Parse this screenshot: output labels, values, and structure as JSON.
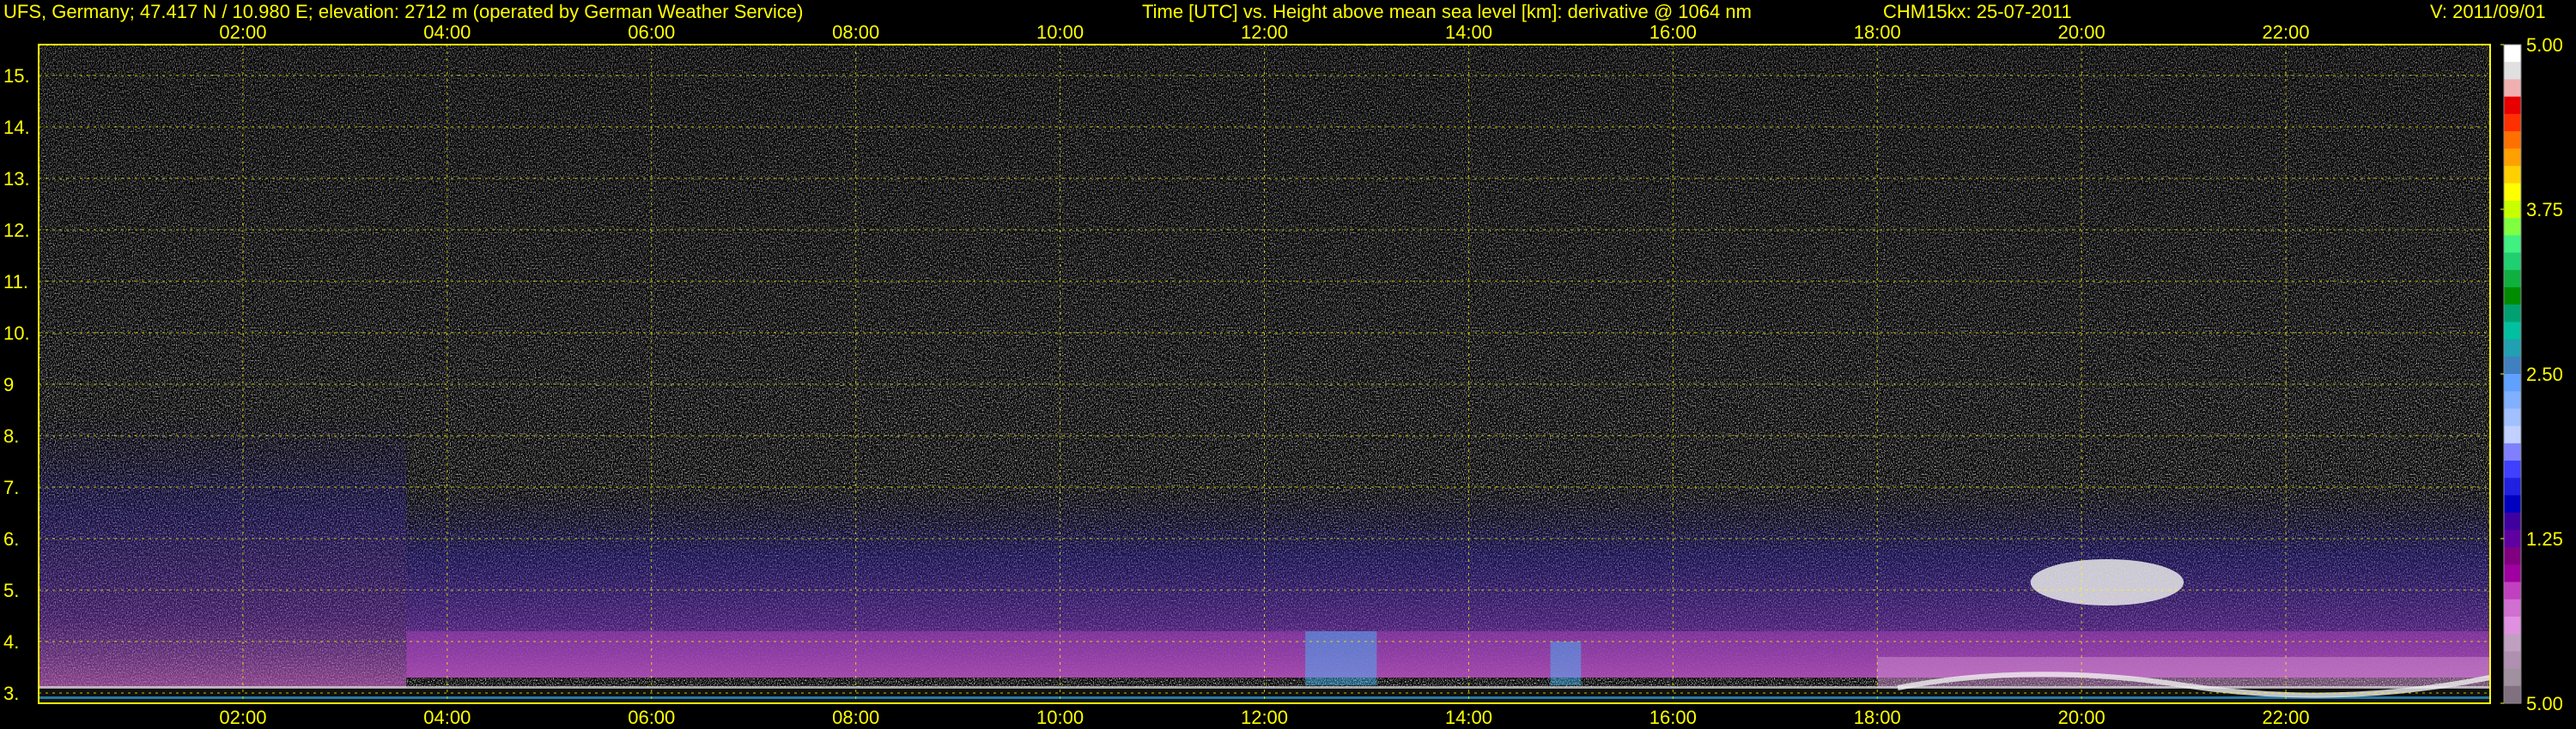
{
  "header": {
    "station": "UFS, Germany; 47.417 N / 10.980 E; elevation: 2712 m  (operated by German Weather Service)",
    "axes_desc": "Time [UTC] vs. Height above mean sea level [km]: derivative @ 1064 nm",
    "instrument": "CHM15kx: 25-07-2011",
    "version": "V: 2011/09/01"
  },
  "chart_data": {
    "type": "heatmap",
    "title": "",
    "xlabel": "",
    "ylabel": "",
    "x_ticks": [
      "02:00",
      "04:00",
      "06:00",
      "08:00",
      "10:00",
      "12:00",
      "14:00",
      "16:00",
      "18:00",
      "20:00",
      "22:00"
    ],
    "x_range_hours": [
      0,
      24
    ],
    "y_ticks": [
      "3.",
      "4.",
      "5.",
      "6.",
      "7.",
      "8.",
      "9",
      "10.",
      "11.",
      "12.",
      "13.",
      "14.",
      "15."
    ],
    "y_tick_values": [
      3,
      4,
      5,
      6,
      7,
      8,
      9,
      10,
      11,
      12,
      13,
      14,
      15
    ],
    "y_range_km": [
      2.8,
      15.6
    ],
    "grid": true,
    "colorbar": {
      "labels": [
        "5.00",
        "3.75",
        "2.50",
        "1.25",
        "5.00"
      ],
      "colors": [
        "#ffffff",
        "#e0e0e0",
        "#f0b0b0",
        "#e80000",
        "#ff3000",
        "#ff7000",
        "#ffa000",
        "#ffd000",
        "#ffff00",
        "#c8ff00",
        "#80ff40",
        "#40f080",
        "#20d070",
        "#10b040",
        "#008c00",
        "#00a070",
        "#00c0a0",
        "#20a0b0",
        "#4080c0",
        "#60a0ff",
        "#80b0ff",
        "#a0c0ff",
        "#c0d0ff",
        "#8080ff",
        "#4040ff",
        "#2020e0",
        "#0000c0",
        "#4000a0",
        "#6000a0",
        "#800080",
        "#a000a0",
        "#c040c0",
        "#d070d0",
        "#e090e0",
        "#c0a0c0",
        "#b090b0",
        "#a090a0",
        "#807080"
      ]
    },
    "features": [
      {
        "name": "boundary-layer",
        "start_h": 0.0,
        "end_h": 24.0,
        "top_km": 3.1
      },
      {
        "name": "aerosol-layer",
        "start_h": 3.6,
        "end_h": 24.0,
        "top_km": 4.2
      },
      {
        "name": "cloud-12-30",
        "start_h": 12.4,
        "end_h": 13.1,
        "base_km": 3.15,
        "top_km": 4.2
      },
      {
        "name": "cloud-14-50",
        "start_h": 14.8,
        "end_h": 15.1,
        "base_km": 3.15,
        "top_km": 4.0
      },
      {
        "name": "cloud-20-00",
        "start_h": 19.5,
        "end_h": 21.0,
        "base_km": 4.7,
        "top_km": 5.6
      },
      {
        "name": "evening-layer",
        "start_h": 18.0,
        "end_h": 24.0,
        "base_km": 3.0,
        "top_km": 3.7
      }
    ]
  }
}
